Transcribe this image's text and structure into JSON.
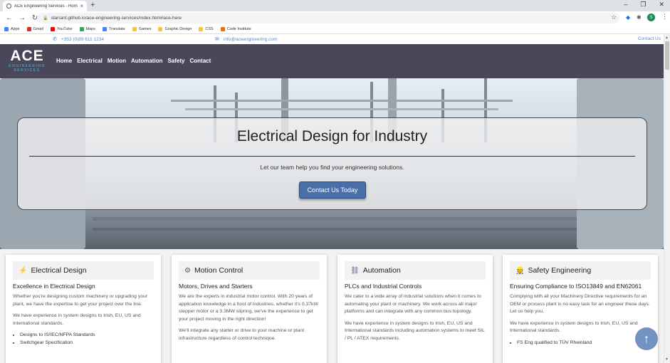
{
  "browser": {
    "tab_title": "ACE Engineering Services - Hom",
    "tab_close": "×",
    "new_tab": "+",
    "window_controls": [
      "–",
      "❐",
      "✕"
    ],
    "url": "starrant.github.io/ace-engineering-services/index.html#ace-here",
    "bookmarks": [
      {
        "label": "Apps",
        "color": "#4285f4"
      },
      {
        "label": "Gmail",
        "color": "#d93025"
      },
      {
        "label": "YouTube",
        "color": "#ff0000"
      },
      {
        "label": "Maps",
        "color": "#34a853"
      },
      {
        "label": "Translate",
        "color": "#4285f4"
      },
      {
        "label": "Games",
        "color": "#f6c343"
      },
      {
        "label": "Graphic Design",
        "color": "#f6c343"
      },
      {
        "label": "CSS",
        "color": "#f6c343"
      },
      {
        "label": "Code Institute",
        "color": "#e8710a"
      }
    ],
    "avatar_letter": "S"
  },
  "topbar": {
    "phone": "+353 (0)89 611 1234",
    "email": "info@aceengineering.com",
    "contact": "Contact Us"
  },
  "navbar": {
    "logo_main": "ACE",
    "logo_line1": "ENGINEERING",
    "logo_line2": "SERVICES",
    "links": [
      "Home",
      "Electrical",
      "Motion",
      "Automation",
      "Safety",
      "Contact"
    ]
  },
  "hero": {
    "title": "Electrical Design for Industry",
    "tagline": "Let our team help you find your engineering solutions.",
    "cta": "Contact Us Today"
  },
  "cards": [
    {
      "icon": "bolt-icon",
      "glyph": "⚡",
      "title": "Electrical Design",
      "subtitle": "Excellence in Electrical Design",
      "paragraphs": [
        "Whether you're designing custom machinery or upgrading your plant, we have the expertise to get your project over the line.",
        "We have experience in system designs to Irish, EU, US and International standards."
      ],
      "list": [
        "Designs to IS/IEC/NFPA Standards",
        "Switchgear Specification"
      ]
    },
    {
      "icon": "gear-icon",
      "glyph": "⚙",
      "title": "Motion Control",
      "subtitle": "Motors, Drives and Starters",
      "paragraphs": [
        "We are the experts in industrial motor control. With 20 years of application knowledge in a host of industries, whether it's 0.37kW stepper motor or a 3.3MW slipring, we've the experience to get your project moving in the right direction!",
        "We'll integrate any starter or drive to your machine or plant infrastructure regardless of control technique."
      ],
      "list": []
    },
    {
      "icon": "network-icon",
      "glyph": "⛓",
      "title": "Automation",
      "subtitle": "PLCs and Industrial Controls",
      "paragraphs": [
        "We cater to a wide array of industrial solutions when it comes to automating your plant or machinery. We work across all major platforms and can integrate with any common bus topology.",
        "We have experience in system designs to Irish, EU, US and International standards including automation systems to meet SIL / PL / ATEX requirements."
      ],
      "list": []
    },
    {
      "icon": "user-shield-icon",
      "glyph": "👷",
      "title": "Safety Engineering",
      "subtitle": "Ensuring Compliance to ISO13849 and EN62061",
      "paragraphs": [
        "Complying with all your Machinery Directive requirements for an OEM or process plant is no easy task for an engineer these days. Let us help you.",
        "We have experience in system designs to Irish, EU, US and International standards."
      ],
      "list": [
        "FS Eng qualified to TÜV Rheinland"
      ]
    }
  ],
  "scroll_top": "↑"
}
